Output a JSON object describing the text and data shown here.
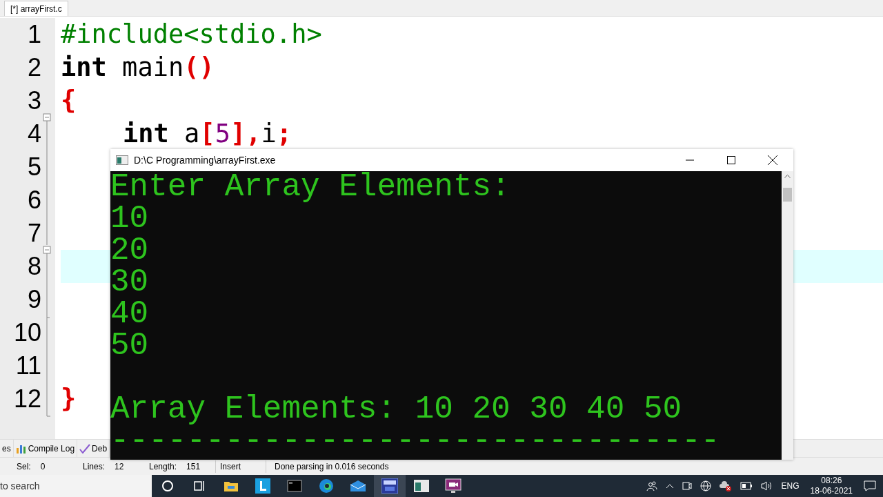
{
  "editor_tab": {
    "label": "[*] arrayFirst.c",
    "selected": true
  },
  "code_lines": [
    {
      "number": "1",
      "highlighted": false,
      "tokens": [
        {
          "kind": "preprocessor",
          "text": "#include<stdio.h>"
        }
      ]
    },
    {
      "number": "2",
      "highlighted": false,
      "tokens": [
        {
          "kind": "keyword",
          "text": "int"
        },
        {
          "kind": "plain",
          "text": " main"
        },
        {
          "kind": "symbol",
          "text": "()"
        }
      ]
    },
    {
      "number": "3",
      "highlighted": false,
      "tokens": [
        {
          "kind": "symbol",
          "text": "{"
        }
      ]
    },
    {
      "number": "4",
      "highlighted": false,
      "indented": true,
      "tokens": [
        {
          "kind": "keyword",
          "text": "int"
        },
        {
          "kind": "plain",
          "text": " a"
        },
        {
          "kind": "symbol",
          "text": "["
        },
        {
          "kind": "number",
          "text": "5"
        },
        {
          "kind": "symbol",
          "text": "],"
        },
        {
          "kind": "plain",
          "text": "i"
        },
        {
          "kind": "symbol",
          "text": ";"
        }
      ]
    },
    {
      "number": "5",
      "highlighted": false
    },
    {
      "number": "6",
      "highlighted": false
    },
    {
      "number": "7",
      "highlighted": false
    },
    {
      "number": "8",
      "highlighted": true
    },
    {
      "number": "9",
      "highlighted": false
    },
    {
      "number": "10",
      "highlighted": false
    },
    {
      "number": "11",
      "highlighted": false
    },
    {
      "number": "12",
      "highlighted": false,
      "tokens": [
        {
          "kind": "symbol",
          "text": "}"
        }
      ]
    }
  ],
  "console": {
    "title": "D:\\C Programming\\arrayFirst.exe",
    "lines": [
      {
        "text": "Enter Array Elements:",
        "blank_before": false
      },
      {
        "text": "10",
        "blank_before": false
      },
      {
        "text": "20",
        "blank_before": false
      },
      {
        "text": "30",
        "blank_before": false
      },
      {
        "text": "40",
        "blank_before": false
      },
      {
        "text": "50",
        "blank_before": false
      },
      {
        "text": "Array Elements: 10 20 30 40 50",
        "blank_before": true
      },
      {
        "text": "--------------------------------",
        "blank_before": false
      }
    ]
  },
  "bottom_tabs": [
    "es",
    "Compile Log",
    "Deb"
  ],
  "status_bar": [
    {
      "label": "Sel:",
      "value": "0"
    },
    {
      "label": "Lines:",
      "value": "12"
    },
    {
      "label": "Length:",
      "value": "151"
    },
    {
      "value": "Insert"
    },
    {
      "value": "Done parsing in 0.016 seconds"
    }
  ],
  "taskbar": {
    "search": "to search",
    "apps": [
      {
        "kind": "cortana",
        "selected": false
      },
      {
        "kind": "taskview",
        "selected": false
      },
      {
        "kind": "explorer",
        "selected": false
      },
      {
        "kind": "l-app",
        "selected": false
      },
      {
        "kind": "terminal",
        "selected": false
      },
      {
        "kind": "edge",
        "selected": false
      },
      {
        "kind": "mail",
        "selected": false
      },
      {
        "kind": "devcpp",
        "selected": true
      },
      {
        "kind": "console",
        "selected": false
      },
      {
        "kind": "recorder",
        "selected": false
      }
    ],
    "language": "ENG",
    "time": "08:26",
    "date": "18-06-2021"
  }
}
